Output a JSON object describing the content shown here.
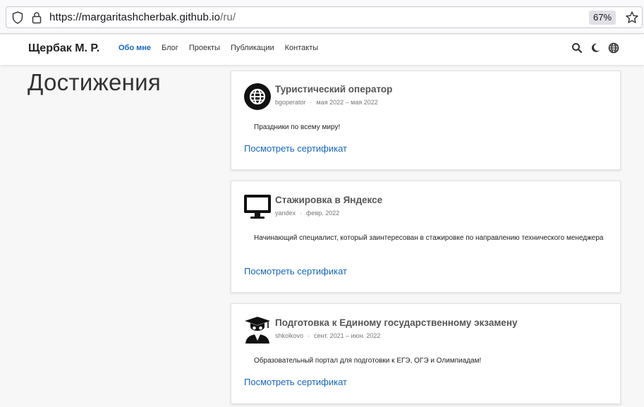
{
  "browser": {
    "url_host": "https://margaritashcherbak.github.io",
    "url_path": "/ru/",
    "zoom": "67%"
  },
  "header": {
    "brand": "Щербак М. Р.",
    "nav": [
      "Обо мне",
      "Блог",
      "Проекты",
      "Публикации",
      "Контакты"
    ],
    "active_index": 0
  },
  "main": {
    "title": "Достижения",
    "cards": [
      {
        "icon": "globe-icon",
        "title": "Туристический оператор",
        "org": "bgoperator",
        "dates": "мая 2022 – мая 2022",
        "description": "Праздники по всему миру!",
        "link": "Посмотреть сертификат"
      },
      {
        "icon": "monitor-icon",
        "title": "Стажировка в Яндексе",
        "org": "yandex",
        "dates": "февр. 2022",
        "description": "Начинающий специалист, который заинтересован в стажировке по направлению технического менеджера",
        "link": "Посмотреть сертификат"
      },
      {
        "icon": "graduate-icon",
        "title": "Подготовка к Единому государственному экзамену",
        "org": "shkolkovo",
        "dates": "сент. 2021 – июн. 2022",
        "description": "Образовательный портал для подготовки к ЕГЭ, ОГЭ и Олимпиадам!",
        "link": "Посмотреть сертификат"
      }
    ]
  }
}
